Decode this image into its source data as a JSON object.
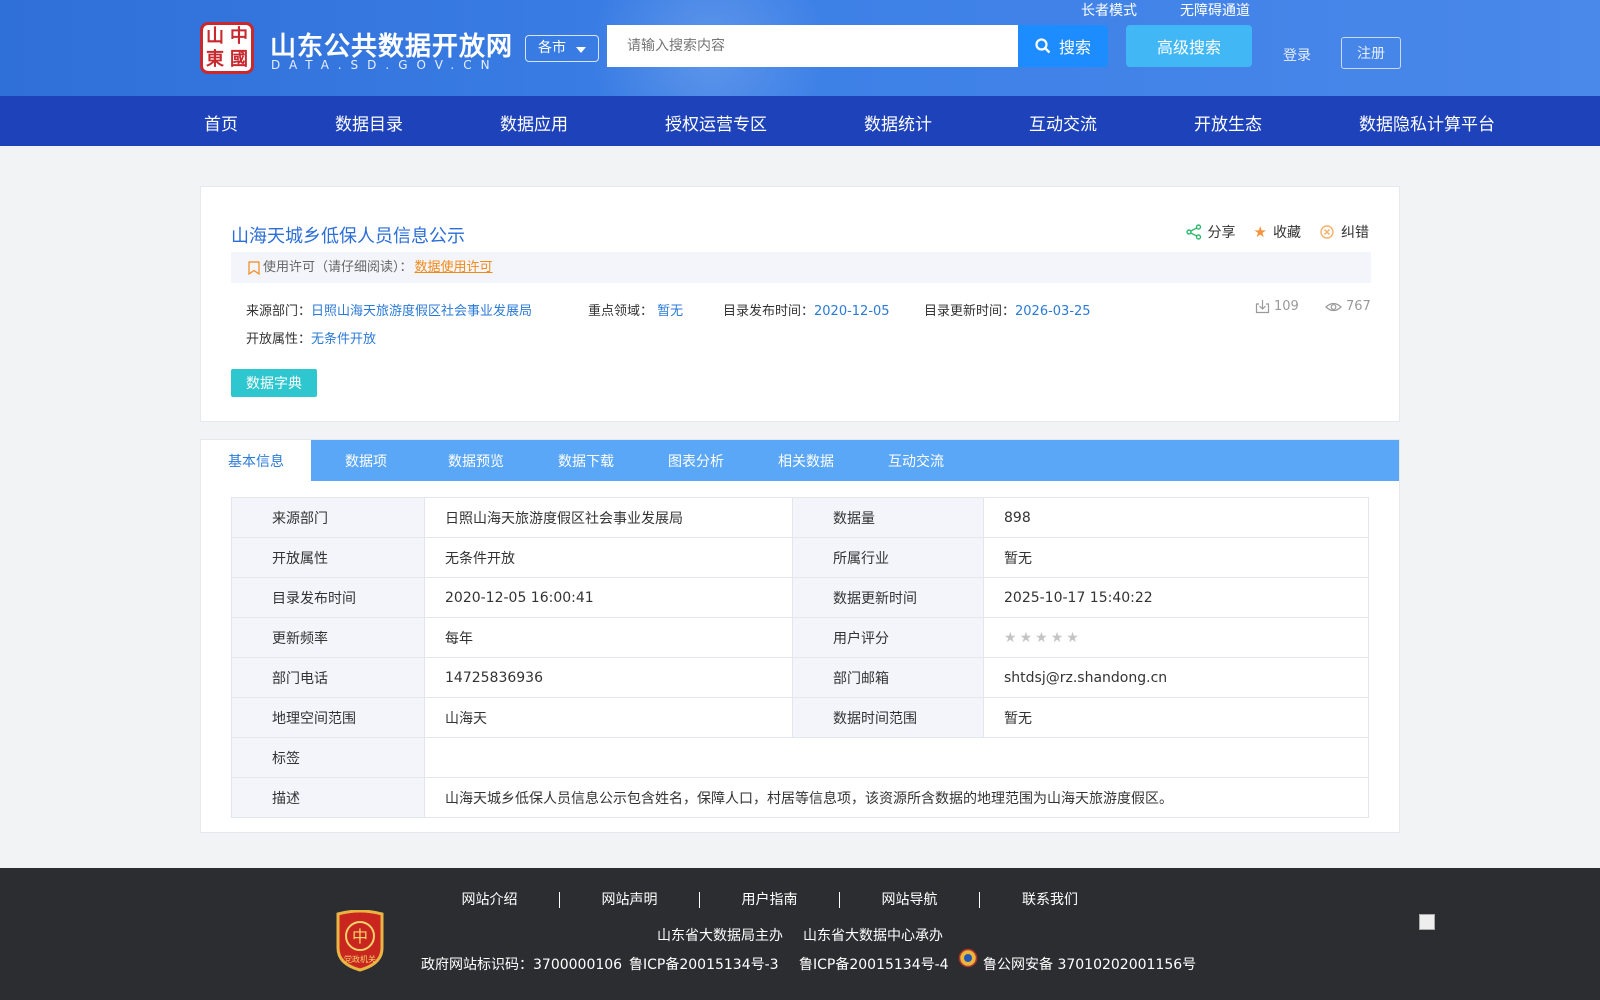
{
  "header": {
    "site_title": "山东公共数据开放网",
    "site_sub": "DATA.SD.GOV.CN",
    "seal_chars": [
      "山",
      "中",
      "東",
      "國"
    ],
    "elder_mode": "长者模式",
    "accessibility": "无障碍通道",
    "city_select": "各市",
    "search_placeholder": "请输入搜索内容",
    "search_label": "搜索",
    "advanced_search": "高级搜索",
    "login": "登录",
    "register": "注册"
  },
  "nav": [
    "首页",
    "数据目录",
    "数据应用",
    "授权运营专区",
    "数据统计",
    "互动交流",
    "开放生态",
    "数据隐私计算平台"
  ],
  "dataset": {
    "title": "山海天城乡低保人员信息公示",
    "actions": {
      "share": "分享",
      "favorite": "收藏",
      "correct": "纠错"
    },
    "license_prefix": "使用许可（请仔细阅读）：",
    "license_link": "数据使用许可",
    "source_label": "来源部门：",
    "source_value": "日照山海天旅游度假区社会事业发展局",
    "focus_label": "重点领域：",
    "focus_value": "暂无",
    "publish_label": "目录发布时间：",
    "publish_value": "2020-12-05",
    "update_label": "目录更新时间：",
    "update_value": "2026-03-25",
    "open_label": "开放属性：",
    "open_value": "无条件开放",
    "downloads": "109",
    "views": "767",
    "dict_button": "数据字典"
  },
  "tabs": [
    "基本信息",
    "数据项",
    "数据预览",
    "数据下载",
    "图表分析",
    "相关数据",
    "互动交流"
  ],
  "info_table": {
    "rows": [
      [
        "来源部门",
        "日照山海天旅游度假区社会事业发展局",
        "数据量",
        "898"
      ],
      [
        "开放属性",
        "无条件开放",
        "所属行业",
        "暂无"
      ],
      [
        "目录发布时间",
        "2020-12-05 16:00:41",
        "数据更新时间",
        "2025-10-17 15:40:22"
      ],
      [
        "更新频率",
        "每年",
        "用户评分",
        ""
      ],
      [
        "部门电话",
        "14725836936",
        "部门邮箱",
        "shtdsj@rz.shandong.cn"
      ],
      [
        "地理空间范围",
        "山海天",
        "数据时间范围",
        "暂无"
      ]
    ],
    "tags_label": "标签",
    "tags_value": "",
    "desc_label": "描述",
    "desc_value": "山海天城乡低保人员信息公示包含姓名，保障人口，村居等信息项，该资源所含数据的地理范围为山海天旅游度假区。",
    "rating_stars": 0,
    "rating_max": 5
  },
  "footer": {
    "links": [
      "网站介绍",
      "网站声明",
      "用户指南",
      "网站导航",
      "联系我们"
    ],
    "host": "山东省大数据局主办",
    "undertaker": "山东省大数据中心承办",
    "gov_id": "政府网站标识码：3700000106",
    "icp3": "鲁ICP备20015134号-3",
    "icp4": "鲁ICP备20015134号-4",
    "police": "鲁公网安备 37010202001156号",
    "badge_text": "党政机关"
  },
  "colors": {
    "header": "#2f6fd8",
    "nav": "#1e42ba",
    "accent": "#1c8cff",
    "tab_bar": "#5ba7f7",
    "footer": "#2c2d30"
  }
}
